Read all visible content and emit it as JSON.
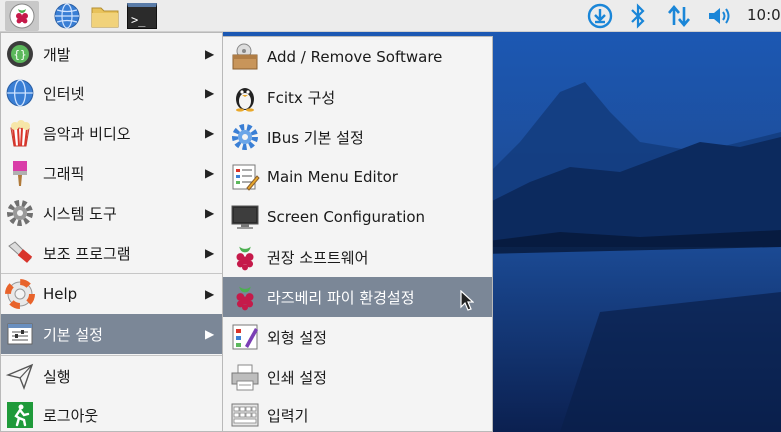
{
  "panel": {
    "launchers": [
      {
        "name": "raspberry-menu-button",
        "icon": "raspberry-icon"
      },
      {
        "name": "web-browser-launcher",
        "icon": "globe-icon"
      },
      {
        "name": "file-manager-launcher",
        "icon": "folder-icon"
      },
      {
        "name": "terminal-launcher",
        "icon": "terminal-icon"
      }
    ],
    "terminal_prompt": ">_",
    "tray": [
      "download-icon",
      "bluetooth-icon",
      "network-icon",
      "volume-icon"
    ],
    "clock": "10:0"
  },
  "main_menu": {
    "items": [
      {
        "label": "개발",
        "icon": "programming-icon",
        "submenu": true
      },
      {
        "label": "인터넷",
        "icon": "globe-icon",
        "submenu": true
      },
      {
        "label": "음악과 비디오",
        "icon": "popcorn-icon",
        "submenu": true
      },
      {
        "label": "그래픽",
        "icon": "paintbrush-icon",
        "submenu": true
      },
      {
        "label": "시스템 도구",
        "icon": "gear-icon",
        "submenu": true
      },
      {
        "label": "보조 프로그램",
        "icon": "knife-icon",
        "submenu": true
      },
      {
        "label": "Help",
        "icon": "lifebuoy-icon",
        "submenu": true
      },
      {
        "label": "기본 설정",
        "icon": "preferences-icon",
        "submenu": true,
        "selected": true
      },
      {
        "label": "실행",
        "icon": "paper-plane-icon",
        "submenu": false
      },
      {
        "label": "로그아웃",
        "icon": "exit-icon",
        "submenu": false
      }
    ],
    "arrow": "▶"
  },
  "sub_menu": {
    "items": [
      {
        "label": "Add / Remove Software",
        "icon": "package-icon"
      },
      {
        "label": "Fcitx 구성",
        "icon": "penguin-icon"
      },
      {
        "label": "IBus 기본 설정",
        "icon": "gear-icon"
      },
      {
        "label": "Main Menu Editor",
        "icon": "menu-editor-icon"
      },
      {
        "label": "Screen Configuration",
        "icon": "monitor-icon"
      },
      {
        "label": "권장 소프트웨어",
        "icon": "raspberry-icon"
      },
      {
        "label": "라즈베리 파이 환경설정",
        "icon": "raspberry-icon",
        "selected": true
      },
      {
        "label": "외형 설정",
        "icon": "appearance-icon"
      },
      {
        "label": "인쇄 설정",
        "icon": "printer-icon"
      },
      {
        "label": "입력기",
        "icon": "keyboard-icon"
      }
    ]
  },
  "colors": {
    "menu_bg": "#f4f4f4",
    "highlight": "#7b8797",
    "panel_bg": "#ececec",
    "tray_blue": "#1a86d8"
  }
}
